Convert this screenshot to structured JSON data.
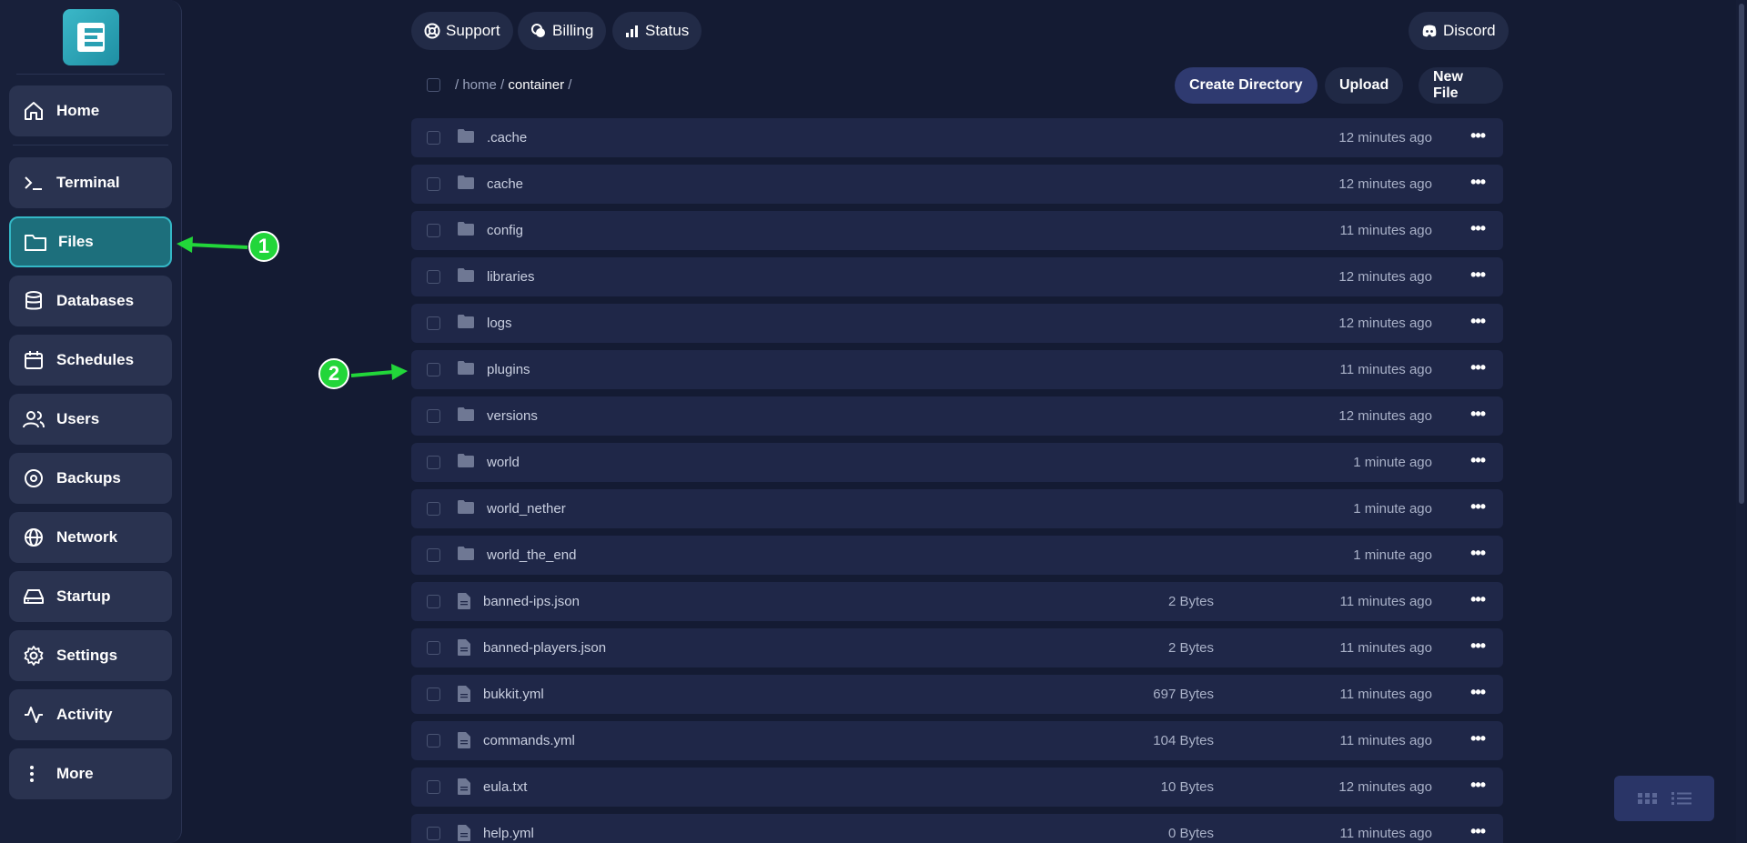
{
  "sidebar": {
    "items": [
      {
        "label": "Home",
        "icon": "home-icon"
      },
      {
        "label": "Terminal",
        "icon": "terminal-icon"
      },
      {
        "label": "Files",
        "icon": "folder-icon",
        "active": true
      },
      {
        "label": "Databases",
        "icon": "database-icon"
      },
      {
        "label": "Schedules",
        "icon": "calendar-icon"
      },
      {
        "label": "Users",
        "icon": "users-icon"
      },
      {
        "label": "Backups",
        "icon": "backup-icon"
      },
      {
        "label": "Network",
        "icon": "globe-icon"
      },
      {
        "label": "Startup",
        "icon": "drive-icon"
      },
      {
        "label": "Settings",
        "icon": "gear-icon"
      },
      {
        "label": "Activity",
        "icon": "activity-icon"
      },
      {
        "label": "More",
        "icon": "more-vertical-icon"
      }
    ]
  },
  "topnav": {
    "support": "Support",
    "billing": "Billing",
    "status": "Status",
    "discord": "Discord"
  },
  "toolbar": {
    "breadcrumb": {
      "sep": "/",
      "home": "home",
      "container": "container"
    },
    "create_directory": "Create Directory",
    "upload": "Upload",
    "new_file": "New File"
  },
  "files": [
    {
      "type": "folder",
      "name": ".cache",
      "size": "",
      "modified": "12 minutes ago"
    },
    {
      "type": "folder",
      "name": "cache",
      "size": "",
      "modified": "12 minutes ago"
    },
    {
      "type": "folder",
      "name": "config",
      "size": "",
      "modified": "11 minutes ago"
    },
    {
      "type": "folder",
      "name": "libraries",
      "size": "",
      "modified": "12 minutes ago"
    },
    {
      "type": "folder",
      "name": "logs",
      "size": "",
      "modified": "12 minutes ago"
    },
    {
      "type": "folder",
      "name": "plugins",
      "size": "",
      "modified": "11 minutes ago"
    },
    {
      "type": "folder",
      "name": "versions",
      "size": "",
      "modified": "12 minutes ago"
    },
    {
      "type": "folder",
      "name": "world",
      "size": "",
      "modified": "1 minute ago"
    },
    {
      "type": "folder",
      "name": "world_nether",
      "size": "",
      "modified": "1 minute ago"
    },
    {
      "type": "folder",
      "name": "world_the_end",
      "size": "",
      "modified": "1 minute ago"
    },
    {
      "type": "file",
      "name": "banned-ips.json",
      "size": "2 Bytes",
      "modified": "11 minutes ago"
    },
    {
      "type": "file",
      "name": "banned-players.json",
      "size": "2 Bytes",
      "modified": "11 minutes ago"
    },
    {
      "type": "file",
      "name": "bukkit.yml",
      "size": "697 Bytes",
      "modified": "11 minutes ago"
    },
    {
      "type": "file",
      "name": "commands.yml",
      "size": "104 Bytes",
      "modified": "11 minutes ago"
    },
    {
      "type": "file",
      "name": "eula.txt",
      "size": "10 Bytes",
      "modified": "12 minutes ago"
    },
    {
      "type": "file",
      "name": "help.yml",
      "size": "0 Bytes",
      "modified": "11 minutes ago"
    }
  ],
  "annotations": {
    "one": "1",
    "two": "2"
  },
  "colors": {
    "accent": "#34b7c6",
    "annotation": "#22d63a"
  }
}
